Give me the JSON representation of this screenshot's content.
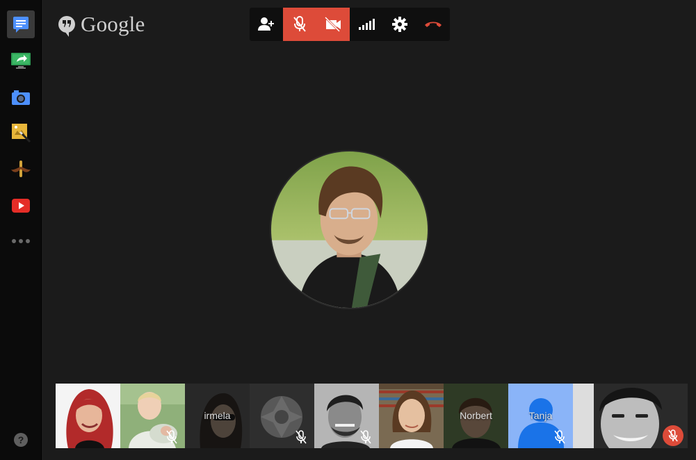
{
  "brand": {
    "name": "Google"
  },
  "rail": {
    "items": [
      {
        "name": "chat-icon",
        "active": true
      },
      {
        "name": "screenshare-icon"
      },
      {
        "name": "camera-icon"
      },
      {
        "name": "effects-icon"
      },
      {
        "name": "mustache-icon"
      },
      {
        "name": "youtube-icon"
      },
      {
        "name": "more-icon"
      }
    ],
    "help_label": "?"
  },
  "toolbar": {
    "buttons": [
      {
        "name": "invite-people",
        "icon": "person-add-icon",
        "active": false
      },
      {
        "name": "microphone-muted",
        "icon": "mic-off-icon",
        "active": true
      },
      {
        "name": "camera-off",
        "icon": "camera-off-icon",
        "active": true
      },
      {
        "name": "bandwidth",
        "icon": "signal-icon",
        "active": false
      },
      {
        "name": "settings",
        "icon": "gear-icon",
        "active": false
      },
      {
        "name": "hang-up",
        "icon": "hang-up-icon",
        "active": false
      }
    ]
  },
  "participants": [
    {
      "id": "p1",
      "name": "",
      "muted": false
    },
    {
      "id": "p2",
      "name": "",
      "muted": true
    },
    {
      "id": "p3",
      "name": "irmela",
      "muted": false
    },
    {
      "id": "p4",
      "name": "",
      "muted": true
    },
    {
      "id": "p5",
      "name": "",
      "muted": true
    },
    {
      "id": "p6",
      "name": "",
      "muted": false
    },
    {
      "id": "p7",
      "name": "Norbert",
      "muted": false
    },
    {
      "id": "p8",
      "name": "Tanja",
      "muted": true
    },
    {
      "id": "p9",
      "name": "",
      "muted": true,
      "self": true
    }
  ],
  "colors": {
    "accent_red": "#dd4b39",
    "background": "#1b1b1b",
    "rail": "#0b0b0b",
    "tanja_blue": "#8ab4f8"
  }
}
